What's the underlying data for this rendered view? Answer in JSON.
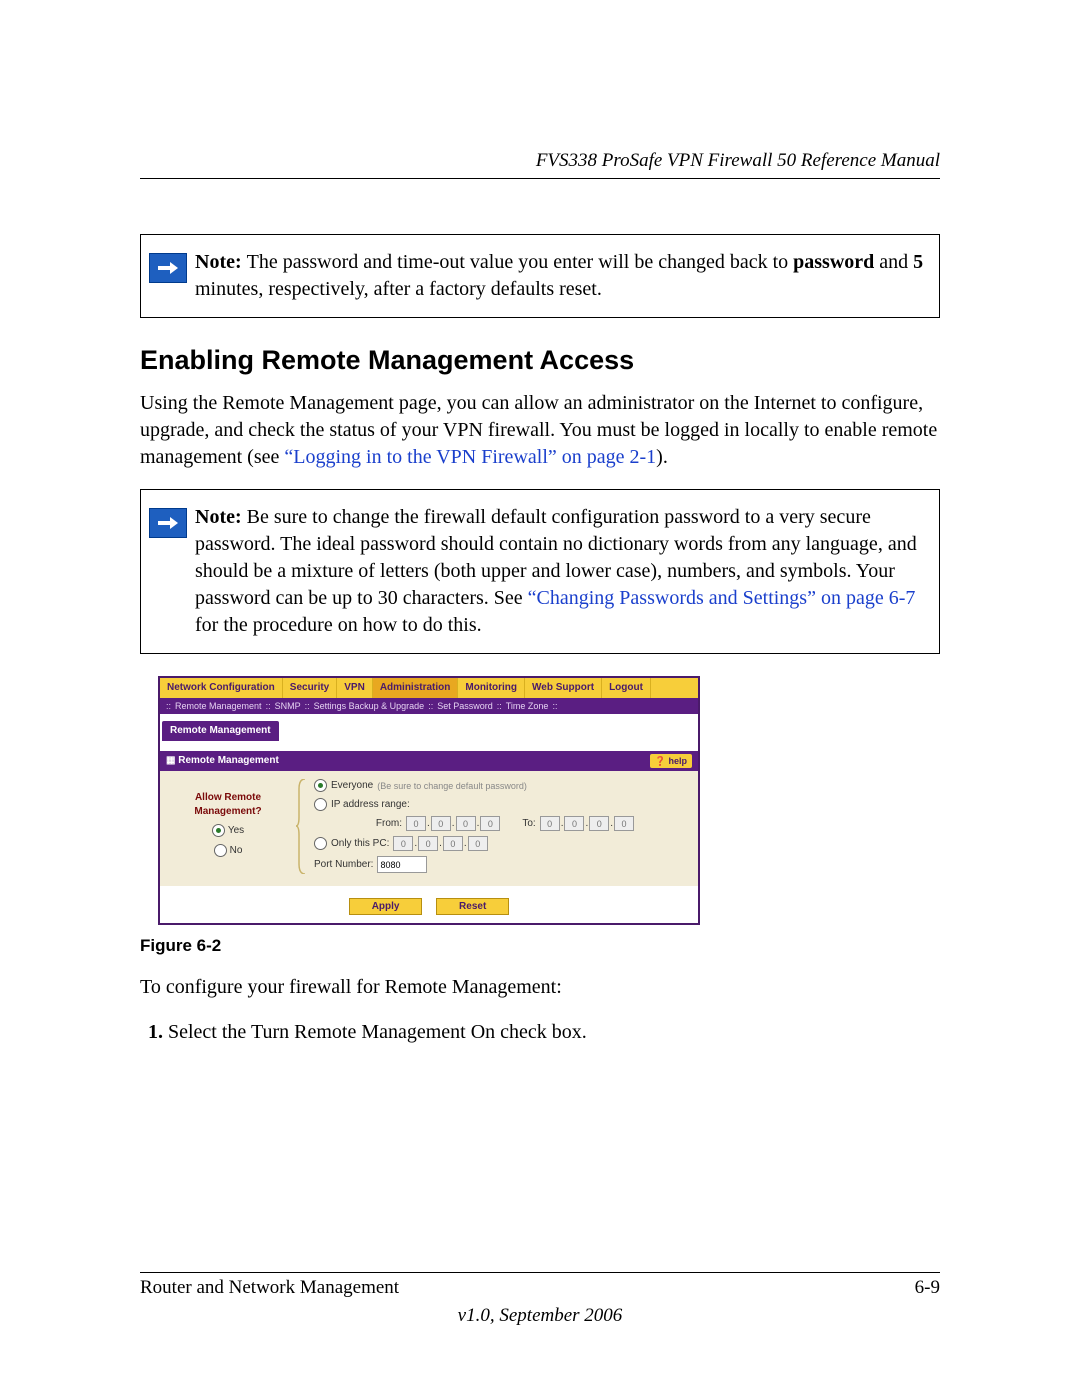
{
  "header": {
    "manual_title": "FVS338 ProSafe VPN Firewall 50 Reference Manual"
  },
  "note1": {
    "prefix": "Note: ",
    "line1a": "The password and time-out value you enter will be changed back to ",
    "bold1": "password",
    "line2a": " and ",
    "bold2": "5",
    "line2b": " minutes, respectively, after a factory defaults reset."
  },
  "section_heading": "Enabling Remote Management Access",
  "para1": {
    "text": "Using the Remote Management page, you can allow an administrator on the Internet to configure, upgrade, and check the status of your VPN firewall. You must be logged in locally to enable remote management (see ",
    "link": "“Logging in to the VPN Firewall” on page 2-1",
    "tail": ")."
  },
  "note2": {
    "prefix": "Note: ",
    "body_a": "Be sure to change the firewall default configuration password to a very secure password. The ideal password should contain no dictionary words from any language, and should be a mixture of letters (both upper and lower case), numbers, and symbols. Your password can be up to 30 characters. See ",
    "link": "“Changing Passwords and Settings” on page 6-7",
    "body_b": " for the procedure on how to do this."
  },
  "ui": {
    "topnav": [
      "Network Configuration",
      "Security",
      "VPN",
      "Administration",
      "Monitoring",
      "Web Support",
      "Logout"
    ],
    "topnav_selected": 3,
    "subnav": [
      "::",
      "Remote Management",
      "::",
      "SNMP",
      "::",
      "Settings Backup & Upgrade",
      "::",
      "Set Password",
      "::",
      "Time Zone",
      "::"
    ],
    "tab": "Remote Management",
    "panel_title": "Remote Management",
    "help_label": "help",
    "left_label_1": "Allow Remote",
    "left_label_2": "Management?",
    "opt_yes": "Yes",
    "opt_no": "No",
    "allow_selected": "yes",
    "scope": {
      "everyone_label": "Everyone",
      "everyone_hint": "(Be sure to change default password)",
      "range_label": "IP address range:",
      "from_label": "From:",
      "to_label": "To:",
      "only_label": "Only this PC:",
      "selected": "everyone"
    },
    "port_label": "Port Number:",
    "port_value": "8080",
    "ip_placeholder": "0",
    "btn_apply": "Apply",
    "btn_reset": "Reset"
  },
  "figure_caption": "Figure 6-2",
  "para2": "To configure your firewall for Remote Management:",
  "step1": "Select the Turn Remote Management On check box.",
  "footer": {
    "left": "Router and Network Management",
    "right": "6-9",
    "version": "v1.0, September 2006"
  }
}
